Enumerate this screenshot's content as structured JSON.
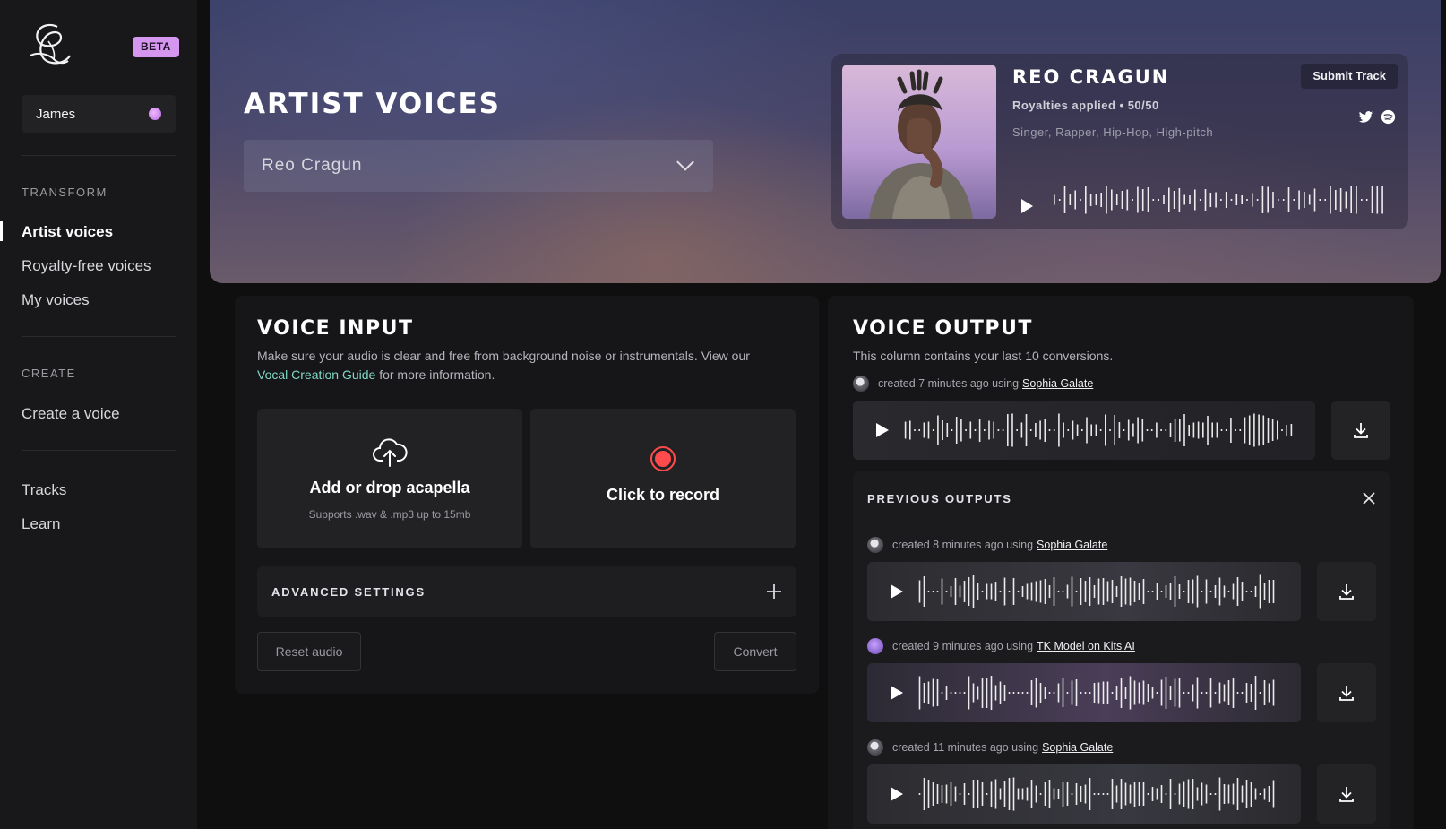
{
  "sidebar": {
    "beta_label": "BETA",
    "user_name": "James",
    "sections": [
      {
        "label": "TRANSFORM",
        "items": [
          {
            "label": "Artist voices",
            "active": true
          },
          {
            "label": "Royalty-free voices"
          },
          {
            "label": "My voices"
          }
        ]
      },
      {
        "label": "CREATE",
        "items": [
          {
            "label": "Create a voice"
          }
        ]
      },
      {
        "label": "",
        "items": [
          {
            "label": "Tracks"
          },
          {
            "label": "Learn"
          }
        ]
      }
    ]
  },
  "hero": {
    "title": "ARTIST VOICES",
    "selected_artist": "Reo Cragun",
    "artist_card": {
      "name": "REO CRAGUN",
      "royalties": "Royalties applied • 50/50",
      "tags": "Singer, Rapper, Hip-Hop, High-pitch",
      "submit_label": "Submit Track",
      "social_icons": [
        "twitter-icon",
        "spotify-icon"
      ]
    }
  },
  "voice_input": {
    "title": "VOICE INPUT",
    "description": "Make sure your audio is clear and free from background noise or instrumentals. View our",
    "guide_link": "Vocal Creation Guide",
    "description_tail": "for more information.",
    "upload_title": "Add or drop acapella",
    "upload_sub": "Supports .wav & .mp3 up to 15mb",
    "record_title": "Click to record",
    "advanced_label": "ADVANCED SETTINGS",
    "reset_label": "Reset audio",
    "convert_label": "Convert"
  },
  "voice_output": {
    "title": "VOICE OUTPUT",
    "description": "This column contains your last 10 conversions.",
    "latest": {
      "meta": "created 7 minutes ago using",
      "model": "Sophia Galate"
    },
    "previous_label": "PREVIOUS OUTPUTS",
    "previous": [
      {
        "meta": "created 8 minutes ago using",
        "model": "Sophia Galate"
      },
      {
        "meta": "created 9 minutes ago using",
        "model": "TK Model on Kits AI"
      },
      {
        "meta": "created 11 minutes ago using",
        "model": "Sophia Galate"
      }
    ]
  },
  "colors": {
    "accent_green": "#7fd8c4",
    "beta_bg": "#d596f0",
    "record_red": "#ff4b4b"
  }
}
